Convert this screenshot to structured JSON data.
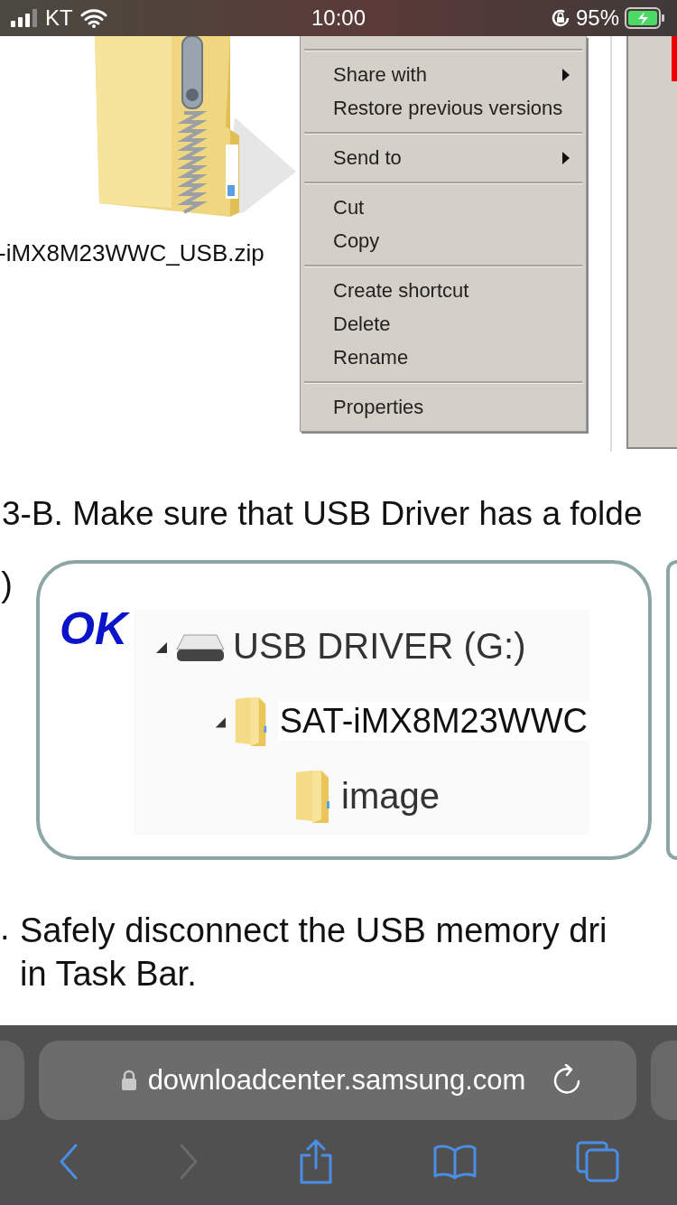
{
  "status_bar": {
    "carrier": "KT",
    "time": "10:00",
    "battery": "95%"
  },
  "document": {
    "zip_file": {
      "name": "-iMX8M23WWC_USB.zip"
    },
    "context_menu": {
      "groups": [
        {
          "items": [
            {
              "label": "Share with",
              "submenu": true
            },
            {
              "label": "Restore previous versions",
              "submenu": false
            }
          ]
        },
        {
          "items": [
            {
              "label": "Send to",
              "submenu": true
            }
          ]
        },
        {
          "items": [
            {
              "label": "Cut",
              "submenu": false
            },
            {
              "label": "Copy",
              "submenu": false
            }
          ]
        },
        {
          "items": [
            {
              "label": "Create shortcut",
              "submenu": false
            },
            {
              "label": "Delete",
              "submenu": false
            },
            {
              "label": "Rename",
              "submenu": false
            }
          ]
        },
        {
          "items": [
            {
              "label": "Properties",
              "submenu": false
            }
          ]
        }
      ]
    },
    "step_heading": "3-B. Make sure that USB Driver has a folde",
    "side_label": ")",
    "example": {
      "status": "OK",
      "tree": [
        {
          "label": "USB DRIVER (G:)",
          "kind": "drive",
          "expanded": true,
          "children": [
            {
              "label": "SAT-iMX8M23WWC",
              "kind": "folder",
              "expanded": true,
              "children": [
                {
                  "label": "image",
                  "kind": "folder"
                }
              ]
            }
          ]
        }
      ]
    },
    "step": {
      "marker": ".",
      "lines": [
        "Safely disconnect the USB memory dri",
        "in Task Bar."
      ]
    }
  },
  "browser": {
    "url": "downloadcenter.samsung.com",
    "toolbar": [
      {
        "kind": "back",
        "disabled": false
      },
      {
        "kind": "forward",
        "disabled": true
      },
      {
        "kind": "share",
        "disabled": false
      },
      {
        "kind": "bookmarks",
        "disabled": false
      },
      {
        "kind": "tabs",
        "disabled": false
      }
    ]
  }
}
